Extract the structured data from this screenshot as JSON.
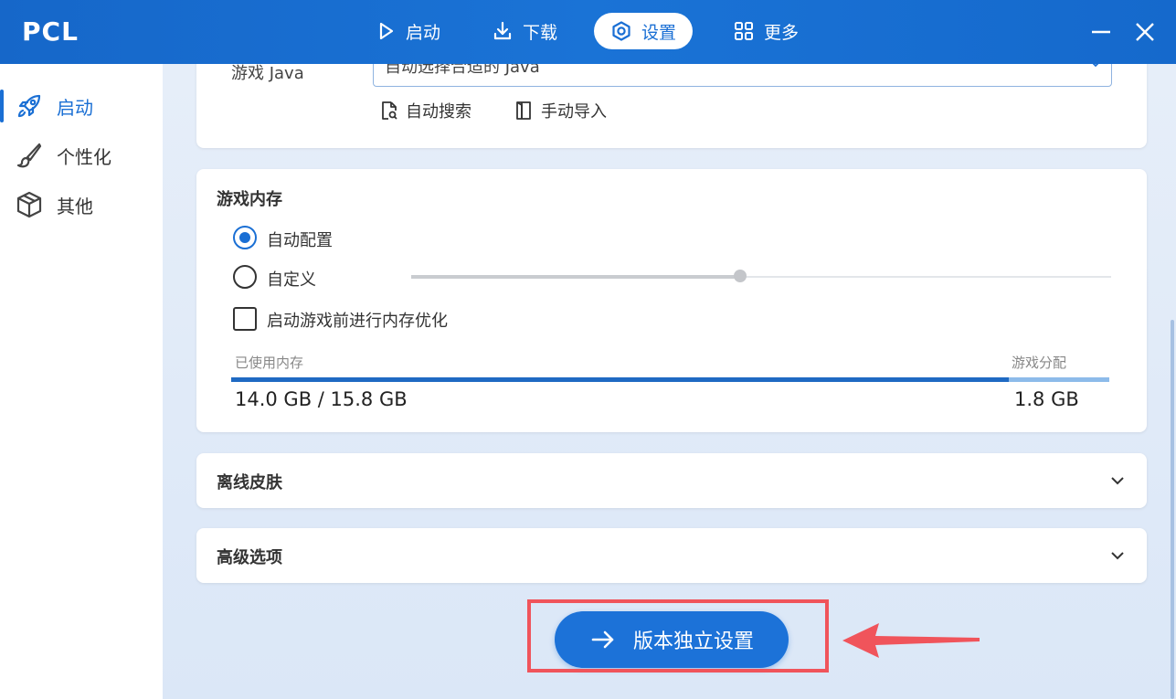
{
  "app": {
    "logo": "PCL"
  },
  "topnav": [
    {
      "label": "启动",
      "icon": "play-icon",
      "active": false
    },
    {
      "label": "下载",
      "icon": "download-icon",
      "active": false
    },
    {
      "label": "设置",
      "icon": "gear-icon",
      "active": true
    },
    {
      "label": "更多",
      "icon": "grid-icon",
      "active": false
    }
  ],
  "window": {
    "minimize_icon": "minimize-icon",
    "close_icon": "close-icon"
  },
  "sidebar": {
    "items": [
      {
        "label": "启动",
        "icon": "rocket-icon",
        "active": true
      },
      {
        "label": "个性化",
        "icon": "brush-icon",
        "active": false
      },
      {
        "label": "其他",
        "icon": "box-icon",
        "active": false
      }
    ]
  },
  "java": {
    "label": "游戏 Java",
    "selected": "自动选择合适的 Java",
    "auto_search": "自动搜索",
    "manual_import": "手动导入"
  },
  "memory": {
    "title": "游戏内存",
    "auto_config": "自动配置",
    "custom": "自定义",
    "optimize": "启动游戏前进行内存优化",
    "used_label": "已使用内存",
    "alloc_label": "游戏分配",
    "used_value": "14.0 GB / 15.8 GB",
    "alloc_value": "1.8 GB",
    "used_fraction": 0.886,
    "slider_fraction": 0.47
  },
  "sections": {
    "offline_skin": "离线皮肤",
    "advanced": "高级选项"
  },
  "primary_button": {
    "label": "版本独立设置",
    "icon": "arrow-right-icon"
  },
  "colors": {
    "accent": "#1a6fd4",
    "highlight": "#f0545b"
  }
}
